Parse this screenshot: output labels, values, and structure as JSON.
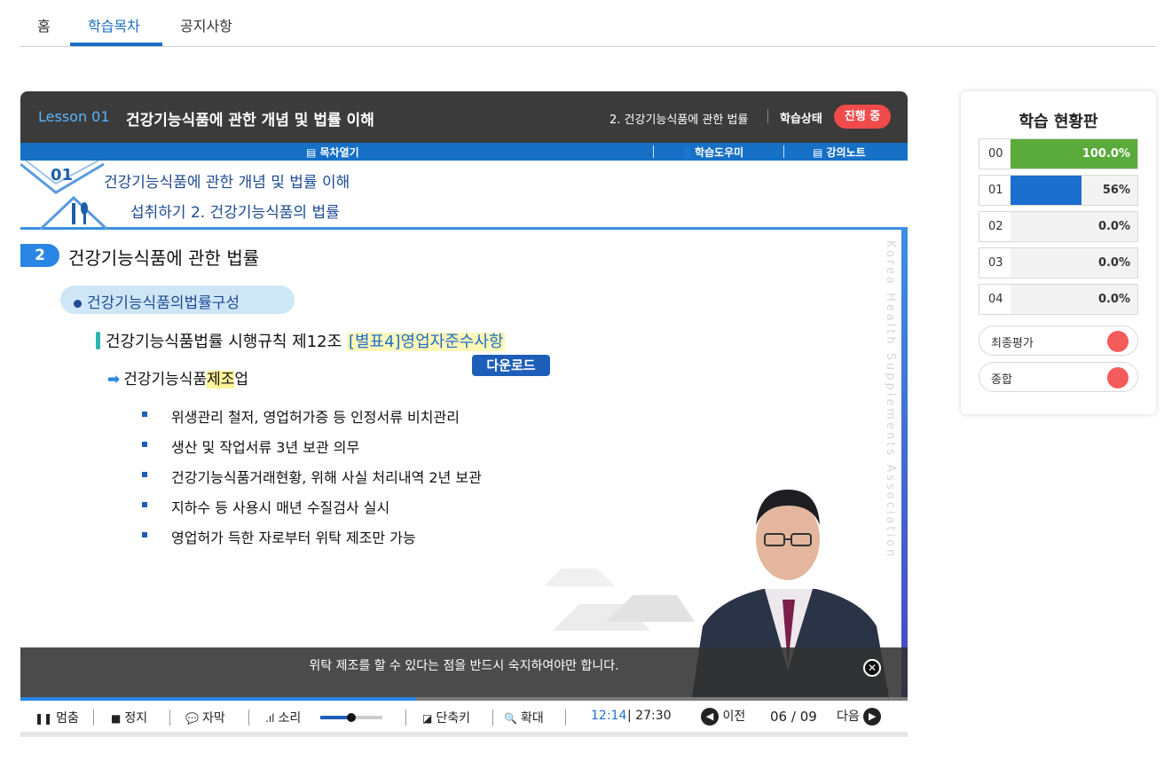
{
  "nav": {
    "tabs": [
      {
        "label": "홈"
      },
      {
        "label": "학습목차"
      },
      {
        "label": "공지사항"
      }
    ],
    "active_index": 1
  },
  "player": {
    "lesson_number": "Lesson 01",
    "lesson_title": "건강기능식품에 관한 개념 및 법률 이해",
    "chapter": "2. 건강기능식품에 관한 법률",
    "status_label": "학습상태",
    "status_value": "진행 중",
    "menu": {
      "toc": "목차열기",
      "helper": "학습도우미",
      "notes": "강의노트"
    }
  },
  "slide": {
    "header_num": "01",
    "header_line1": "건강기능식품에 관한 개념 및 법률 이해",
    "header_line2": "섭취하기 2. 건강기능식품의 법률",
    "section_num": "2",
    "section_title": "건강기능식품에 관한 법률",
    "pill": "건강기능식품의법률구성",
    "rule_text": "건강기능식품법률 시행규칙 제12조 ",
    "rule_highlight": "[별표4]영업자준수사항",
    "download": "다운로드",
    "sub_prefix": "건강기능식품",
    "sub_highlight": "제조",
    "sub_suffix": "업",
    "bullets": [
      "위생관리 철저, 영업허가증 등 인정서류 비치관리",
      "생산 및 작업서류 3년 보관 의무",
      "건강기능식품거래현황, 위해 사실 처리내역 2년 보관",
      "지하수 등 사용시 매년 수질검사 실시",
      "영업허가 득한 자로부터 위탁 제조만 가능"
    ],
    "watermark": "Korea Health Supplements Association"
  },
  "caption": {
    "text": "위탁 제조를 할 수 있다는 점을 반드시 숙지하여야만 합니다."
  },
  "controls": {
    "pause": "멈춤",
    "stop": "정지",
    "subtitle": "자막",
    "sound": "소리",
    "volume": 0.5,
    "shortcut": "단축키",
    "zoom": "확대",
    "time_current": "12:14",
    "time_total": "27:30",
    "prev": "이전",
    "next": "다음",
    "page_current": "06",
    "page_total": "09",
    "progress": 0.446
  },
  "status_panel": {
    "title": "학습 현황판",
    "rows": [
      {
        "id": "00",
        "value": "100.0%",
        "percent": 100,
        "color": "#5aaa3c"
      },
      {
        "id": "01",
        "value": "56%",
        "percent": 56,
        "color": "#1c6ecf"
      },
      {
        "id": "02",
        "value": "0.0%",
        "percent": 0,
        "color": "#1c6ecf"
      },
      {
        "id": "03",
        "value": "0.0%",
        "percent": 0,
        "color": "#1c6ecf"
      },
      {
        "id": "04",
        "value": "0.0%",
        "percent": 0,
        "color": "#1c6ecf"
      }
    ],
    "final_eval": "최종평가",
    "overall": "종합"
  }
}
